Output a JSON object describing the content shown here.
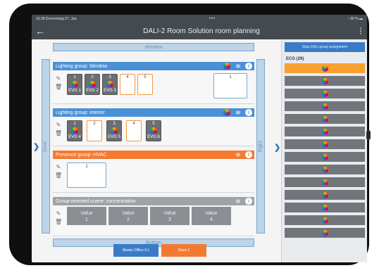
{
  "status": {
    "time": "16:38",
    "date": "Donnerstag 27. Jan.",
    "dots": "•••",
    "battery": "90 %"
  },
  "appbar": {
    "back_icon": "←",
    "title": "DALI-2 Room Solution room planning",
    "menu_icon": "⋮"
  },
  "walls": {
    "top": "Window",
    "left": "Door",
    "right": "Right",
    "bottom": "Bottom"
  },
  "arrows": {
    "left": "❯",
    "right": "❯"
  },
  "groups": [
    {
      "name": "Lighting group: Window",
      "color": "#4a90d6",
      "slots": [
        {
          "num": "1",
          "evg": "EVG 1",
          "filled": true
        },
        {
          "num": "2",
          "evg": "EVG 2",
          "filled": true
        },
        {
          "num": "3",
          "evg": "EVG 3",
          "filled": true
        },
        {
          "num": "4",
          "evg": "",
          "filled": false
        },
        {
          "num": "5",
          "evg": "",
          "filled": false
        }
      ],
      "big": "1"
    },
    {
      "name": "Lighting group: interior",
      "color": "#4a90d6",
      "slots": [
        {
          "num": "1",
          "evg": "EVG 4",
          "filled": true
        },
        {
          "num": "2",
          "evg": "",
          "filled": false
        },
        {
          "num": "3",
          "evg": "EVG 5",
          "filled": true
        },
        {
          "num": "4",
          "evg": "",
          "filled": false
        },
        {
          "num": "5",
          "evg": "EVG 6",
          "filled": true
        }
      ]
    },
    {
      "name": "Presence group: HVAC",
      "color": "#f47a32",
      "big": "1"
    },
    {
      "name": "Group-oriented scene: concentration",
      "color": "#9ea3a8",
      "scenes": [
        {
          "label": "Value",
          "num": "1"
        },
        {
          "label": "Value",
          "num": "2"
        },
        {
          "label": "Value",
          "num": "3"
        },
        {
          "label": "Value",
          "num": "4"
        }
      ]
    }
  ],
  "buttons": {
    "master": "Master Office 3.1",
    "slave": "Slave 1"
  },
  "sidebar": {
    "stop_label": "Stop DALI group assignment",
    "ecg_label": "ECG (29)",
    "visible_count": 14
  },
  "colors": {
    "accent": "#3a7bc8",
    "orange": "#f47a32",
    "dark": "#454a50"
  }
}
